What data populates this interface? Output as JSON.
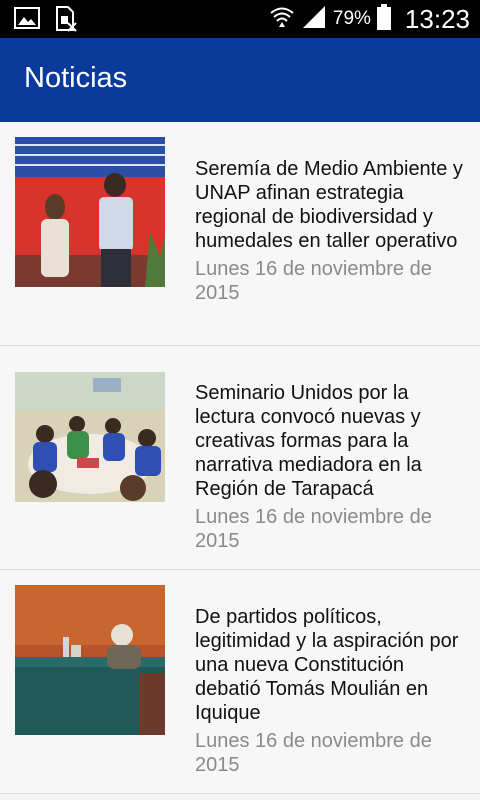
{
  "status_bar": {
    "battery_percent": "79%",
    "time": "13:23",
    "icons": [
      "image-icon",
      "sim-icon",
      "wifi-icon",
      "signal-icon",
      "battery-icon"
    ]
  },
  "app_bar": {
    "title": "Noticias"
  },
  "news": [
    {
      "headline": "Seremía de Medio Ambiente y UNAP afinan estrategia regional de biodiversidad y humedales en taller operativo",
      "date": "Lunes 16 de noviembre de 2015"
    },
    {
      "headline": "Seminario  Unidos por la lectura  convocó nuevas y creativas formas para la narrativa mediadora en la Región de Tarapacá",
      "date": "Lunes 16 de noviembre de 2015"
    },
    {
      "headline": "De partidos políticos, legitimidad y la aspiración por una nueva Constitución debatió Tomás Moulián en Iquique",
      "date": "Lunes 16 de noviembre de 2015"
    }
  ],
  "colors": {
    "app_bar": "#0a3a9b",
    "status_bar": "#000000",
    "date_text": "#8a8a8a"
  }
}
